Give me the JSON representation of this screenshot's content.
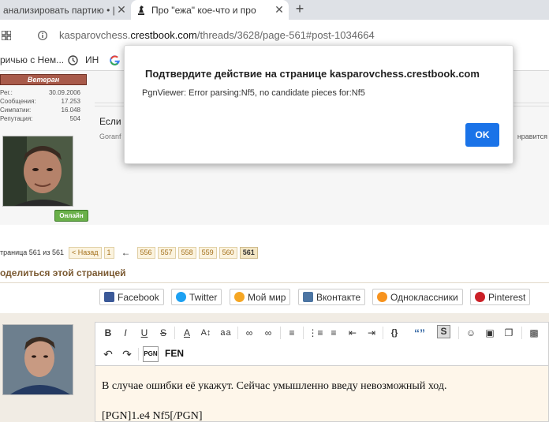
{
  "browser": {
    "tabs": [
      {
        "title": "анализировать партию • |",
        "close": "✕"
      },
      {
        "title": "Про \"ежа\" кое-что и про",
        "close": "✕"
      }
    ],
    "new_tab": "+",
    "url_prefix": "kasparovchess.",
    "url_domain": "crestbook.com",
    "url_path": "/threads/3628/page-561#post-1034664",
    "bookmarks": [
      "ричью с Нем...",
      "ИН"
    ]
  },
  "sidebar_user1": {
    "rank": "Ветеран",
    "stats": [
      {
        "label": "Рег.:",
        "value": "30.09.2006"
      },
      {
        "label": "Сообщения:",
        "value": "17.253"
      },
      {
        "label": "Симпатии:",
        "value": "16.048"
      },
      {
        "label": "Репутация:",
        "value": "504"
      }
    ],
    "status": "Онлайн"
  },
  "post": {
    "text": "Если",
    "author": "Goranf",
    "likes": "нравится"
  },
  "pagination": {
    "label": "траница 561 из 561",
    "prev": "< Назад",
    "first": "1",
    "arrow": "←",
    "pages": [
      "556",
      "557",
      "558",
      "559",
      "560"
    ],
    "current": "561"
  },
  "share": {
    "title": "оделиться этой страницей",
    "buttons": [
      {
        "label": "Facebook",
        "color": "#3b5998"
      },
      {
        "label": "Twitter",
        "color": "#1da1f2"
      },
      {
        "label": "Мой мир",
        "color": "#f5a623"
      },
      {
        "label": "Вконтакте",
        "color": "#4c75a3"
      },
      {
        "label": "Одноклассники",
        "color": "#f7931e"
      },
      {
        "label": "Pinterest",
        "color": "#cb2027"
      }
    ]
  },
  "editor": {
    "pgn_label": "PGN",
    "fen_label": "FEN",
    "line1": "В случае ошибки её укажут. Сейчас умышленно введу невозможный ход.",
    "line2": "[PGN]1.e4 Nf5[/PGN]"
  },
  "dialog": {
    "title": "Подтвердите действие на странице kasparovchess.crestbook.com",
    "message": "PgnViewer: Error parsing:Nf5, no candidate pieces for:Nf5",
    "ok": "OK"
  }
}
